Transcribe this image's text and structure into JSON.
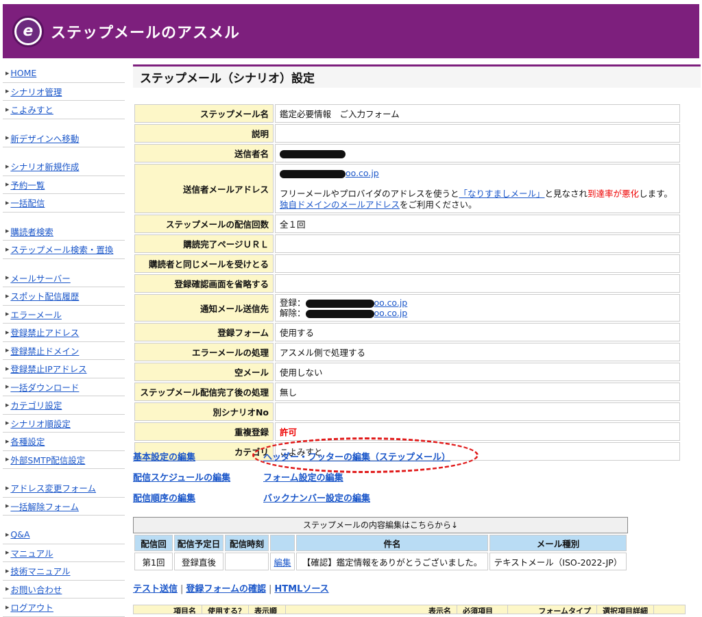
{
  "header": {
    "logo_letter": "e",
    "title": "ステップメールのアスメル"
  },
  "sidebar": {
    "groups": [
      [
        "HOME",
        "シナリオ管理",
        "こよみすと"
      ],
      [
        "新デザインへ移動"
      ],
      [
        "シナリオ新規作成",
        "予約一覧",
        "一括配信"
      ],
      [
        "購読者検索",
        "ステップメール検索・置換"
      ],
      [
        "メールサーバー",
        "スポット配信履歴",
        "エラーメール",
        "登録禁止アドレス",
        "登録禁止ドメイン",
        "登録禁止IPアドレス",
        "一括ダウンロード",
        "カテゴリ設定",
        "シナリオ順設定",
        "各種設定",
        "外部SMTP配信設定"
      ],
      [
        "アドレス変更フォーム",
        "一括解除フォーム"
      ],
      [
        "Q&A",
        "マニュアル",
        "技術マニュアル",
        "お問い合わせ",
        "ログアウト"
      ]
    ]
  },
  "page_title": "ステップメール（シナリオ）設定",
  "settings": {
    "name_label": "ステップメール名",
    "name_value": "鑑定必要情報　ご入力フォーム",
    "desc_label": "説明",
    "desc_value": "",
    "sender_label": "送信者名",
    "sender_email_label": "送信者メールアドレス",
    "sender_email_value": "oo.co.jp",
    "notice_prefix": "フリーメールやプロバイダのアドレスを使うと",
    "notice_link": "「なりすましメール」",
    "notice_mid": "と見なされ",
    "notice_red": "到達率が悪化",
    "notice_suffix": "します。",
    "notice_link2": "独自ドメインのメールアドレス",
    "notice_end": "をご利用ください。",
    "count_label": "ステップメールの配信回数",
    "count_value": "全１回",
    "complete_label": "購読完了ページＵＲＬ",
    "complete_value": "",
    "same_label": "購読者と同じメールを受けとる",
    "same_value": "",
    "skip_label": "登録確認画面を省略する",
    "skip_value": "",
    "notify_label": "通知メール送信先",
    "notify_reg_prefix": "登録：",
    "notify_reg_value": "oo.co.jp",
    "notify_unreg_prefix": "解除：",
    "notify_unreg_value": "oo.co.jp",
    "form_label": "登録フォーム",
    "form_value": "使用する",
    "error_label": "エラーメールの処理",
    "error_value": "アスメル側で処理する",
    "empty_label": "空メール",
    "empty_value": "使用しない",
    "after_label": "ステップメール配信完了後の処理",
    "after_value": "無し",
    "other_label": "別シナリオNo",
    "other_value": "",
    "dup_label": "重複登録",
    "dup_value": "許可",
    "cat_label": "カテゴリ",
    "cat_value": "こよみすと"
  },
  "edit_links": {
    "basic": "基本設定の編集",
    "header_footer": "ヘッダー・フッターの編集（ステップメール）",
    "schedule": "配信スケジュールの編集",
    "form": "フォーム設定の編集",
    "order": "配信順序の編集",
    "backnumber": "バックナンバー設定の編集"
  },
  "content_table": {
    "caption": "ステップメールの内容編集はこちらから↓",
    "headers": [
      "配信回",
      "配信予定日",
      "配信時刻",
      "",
      "件名",
      "メール種別"
    ],
    "row": {
      "no": "第1回",
      "date": "登録直後",
      "time": "",
      "edit": "編集",
      "subject": "【確認】鑑定情報をありがとうございました。",
      "type": "テキストメール（ISO-2022-JP）"
    }
  },
  "bottom_links": [
    "テスト送信",
    "登録フォームの確認",
    "HTMLソース"
  ],
  "bottom_sep": "|",
  "field_table_headers": [
    "項目名",
    "使用する？",
    "表示順",
    "表示名",
    "必須項目",
    "フォームタイプ",
    "選択項目詳細"
  ]
}
